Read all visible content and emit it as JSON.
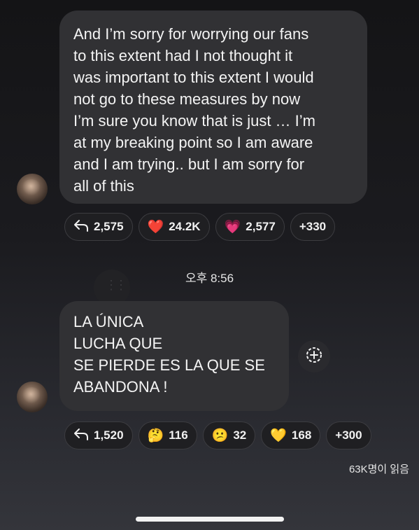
{
  "messages": [
    {
      "lines": [
        "And I’m sorry for worrying our fans",
        "to this extent had I not thought it",
        "was important to this extent I would",
        "not go to these measures by now",
        "I’m sure you know that is just … I’m",
        "at my breaking point so I am aware",
        "and I am trying.. but I am sorry for",
        "all of this"
      ],
      "reactions": [
        {
          "icon": "reply-icon",
          "glyph": "↰",
          "count": "2,575"
        },
        {
          "icon": "red-heart-icon",
          "glyph": "❤️",
          "count": "24.2K"
        },
        {
          "icon": "sparkling-heart-icon",
          "glyph": "💗",
          "count": "2,577"
        },
        {
          "icon": "",
          "glyph": "",
          "count": "+330"
        }
      ]
    },
    {
      "lines": [
        "LA ÚNICA",
        "LUCHA QUE",
        "SE PIERDE ES LA QUE SE",
        "ABANDONA !"
      ],
      "reactions": [
        {
          "icon": "reply-icon",
          "glyph": "↰",
          "count": "1,520"
        },
        {
          "icon": "thinking-face-icon",
          "glyph": "🤔",
          "count": "116"
        },
        {
          "icon": "confused-face-icon",
          "glyph": "😕",
          "count": "32"
        },
        {
          "icon": "yellow-heart-icon",
          "glyph": "💛",
          "count": "168"
        },
        {
          "icon": "",
          "glyph": "",
          "count": "+300"
        }
      ]
    }
  ],
  "timestamp": "오후 8:56",
  "read_receipt": "63K명이 읽음",
  "colors": {
    "bubble": "#313134",
    "pill": "#1f1f22",
    "background": "#1b1b1f"
  }
}
